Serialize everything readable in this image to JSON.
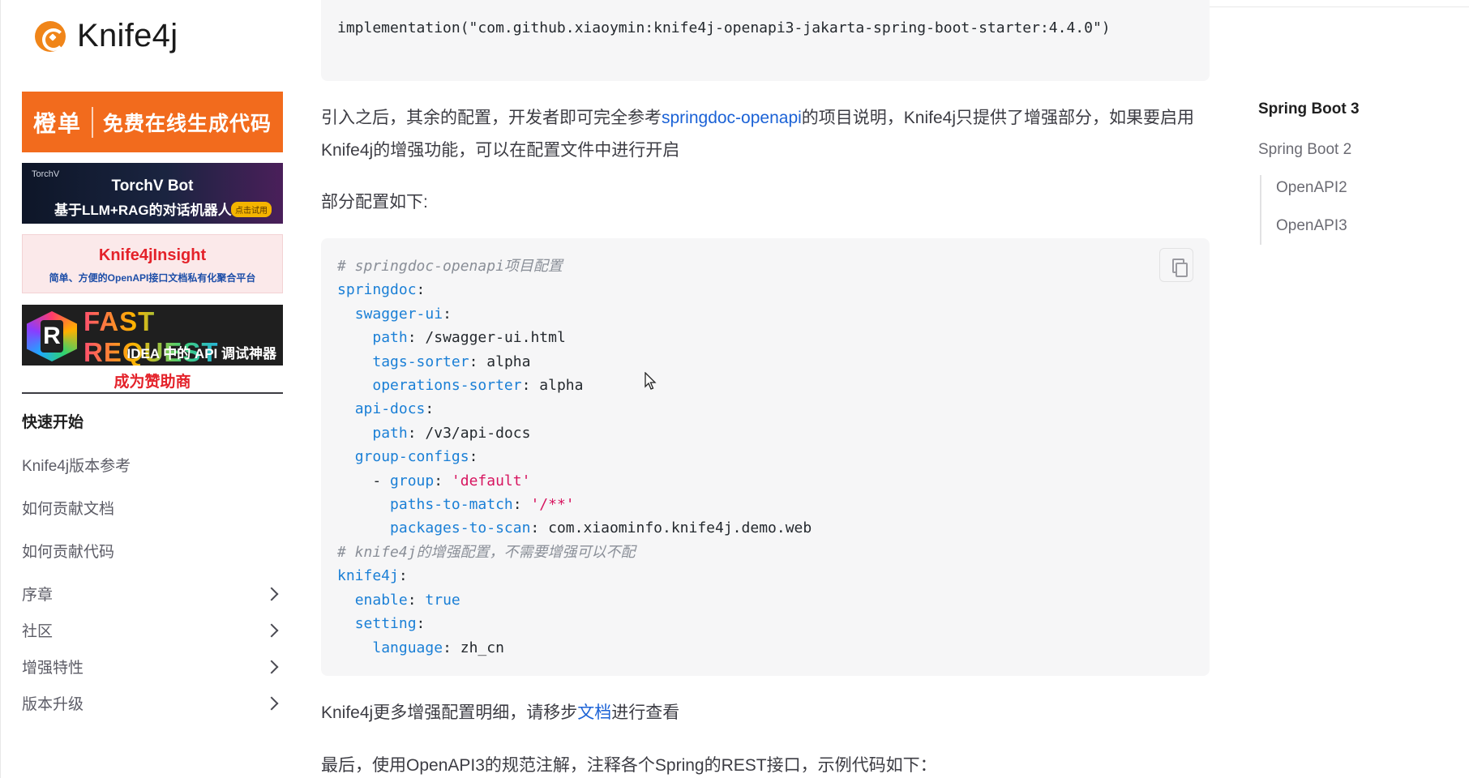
{
  "sidebar": {
    "logo_text": "Knife4j",
    "ads": {
      "orange": {
        "left": "橙单",
        "right": "免费在线生成代码"
      },
      "torch": {
        "brand": "TorchV",
        "title": "TorchV Bot",
        "subtitle": "基于LLM+RAG的对话机器人",
        "pill": "点击试用"
      },
      "insight": {
        "title": "Knife4jInsight",
        "subtitle": "简单、方便的OpenAPI接口文档私有化聚合平台"
      },
      "fast": {
        "title": "FAST REQUEST",
        "subtitle": "IDEA 中的 API 调试神器"
      }
    },
    "sponsor": "成为赞助商",
    "nav_title": "快速开始",
    "items": [
      {
        "label": "Knife4j版本参考"
      },
      {
        "label": "如何贡献文档"
      },
      {
        "label": "如何贡献代码"
      },
      {
        "label": "序章"
      },
      {
        "label": "社区"
      },
      {
        "label": "增强特性"
      },
      {
        "label": "版本升级"
      }
    ]
  },
  "main": {
    "top_code": "implementation(\"com.github.xiaoymin:knife4j-openapi3-jakarta-spring-boot-starter:4.4.0\")",
    "para1_a": "引入之后，其余的配置，开发者即可完全参考",
    "para1_link": "springdoc-openapi",
    "para1_b": "的项目说明，Knife4j只提供了增强部分，如果要启用Knife4j的增强功能，可以在配置文件中进行开启",
    "para2": "部分配置如下:",
    "para3_a": "Knife4j更多增强配置明细，请移步",
    "para3_link": "文档",
    "para3_b": "进行查看",
    "para4": "最后，使用OpenAPI3的规范注解，注释各个Spring的REST接口，示例代码如下：",
    "code": {
      "comment1": "# springdoc-openapi项目配置",
      "springdoc": "springdoc",
      "swagger_ui": "swagger-ui",
      "path": "path",
      "path_val": "/swagger-ui.html",
      "tags_sorter": "tags-sorter",
      "tags_sorter_val": "alpha",
      "operations_sorter": "operations-sorter",
      "operations_sorter_val": "alpha",
      "api_docs": "api-docs",
      "path2": "path",
      "path2_val": "/v3/api-docs",
      "group_configs": "group-configs",
      "group": "group",
      "group_val": "'default'",
      "paths_to_match": "paths-to-match",
      "paths_to_match_val": "'/**'",
      "packages_to_scan": "packages-to-scan",
      "packages_to_scan_val": "com.xiaominfo.knife4j.demo.web",
      "comment2": "# knife4j的增强配置，不需要增强可以不配",
      "knife4j": "knife4j",
      "enable": "enable",
      "enable_val": "true",
      "setting": "setting",
      "language": "language",
      "language_val": "zh_cn"
    }
  },
  "toc": {
    "active": "Spring Boot 3",
    "items": [
      "Spring Boot 2",
      "OpenAPI2",
      "OpenAPI3"
    ]
  },
  "colors": {
    "link": "#1b62d6",
    "code_key": "#1a7fd6",
    "code_string": "#d7155f",
    "code_bg": "#f6f6f7",
    "logo_orange": "#f08519"
  }
}
